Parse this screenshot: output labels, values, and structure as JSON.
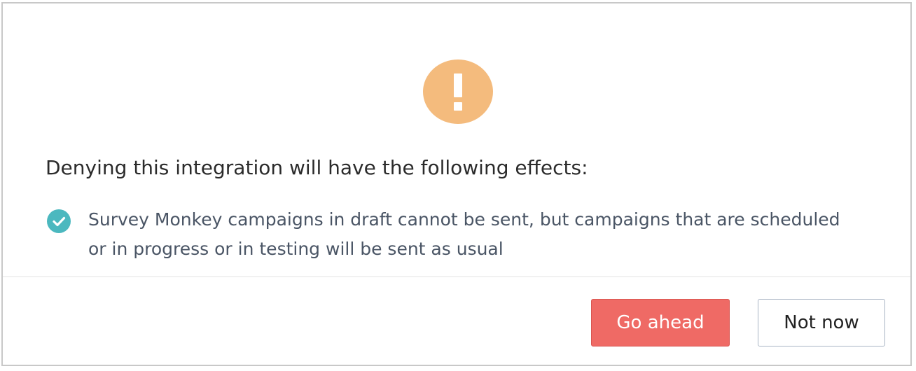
{
  "dialog": {
    "heading": "Denying this integration will have the following effects:",
    "icon": "exclamation-icon",
    "accent_color": "#f4bb7d",
    "effects": [
      {
        "icon": "check-circle-icon",
        "icon_color": "#4bb8bf",
        "text": "Survey Monkey campaigns in draft cannot be sent, but campaigns that are scheduled or in progress or in testing will be sent as usual"
      }
    ],
    "buttons": {
      "confirm_label": "Go ahead",
      "confirm_color": "#ef6a65",
      "cancel_label": "Not now"
    }
  }
}
